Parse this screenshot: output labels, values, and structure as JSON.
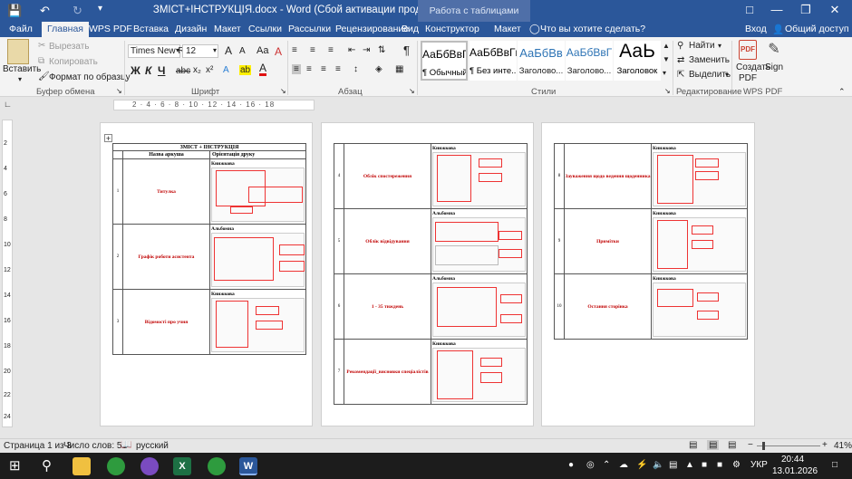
{
  "titlebar": {
    "title": "ЗМІСТ+ІНСТРУКЦІЯ.docx - Word (Сбой активации продукта)",
    "context_tab": "Работа с таблицами",
    "save_icon": "save-icon",
    "undo_icon": "undo-icon",
    "redo_icon": "redo-icon",
    "customize_icon": "customize-icon"
  },
  "tabs": [
    "Файл",
    "Главная",
    "WPS PDF",
    "Вставка",
    "Дизайн",
    "Макет",
    "Ссылки",
    "Рассылки",
    "Рецензирование",
    "Вид",
    "Конструктор",
    "Макет"
  ],
  "tell_me": "Что вы хотите сделать?",
  "signin": "Вход",
  "share": "Общий доступ",
  "clipboard": {
    "paste": "Вставить",
    "cut": "Вырезать",
    "copy": "Копировать",
    "format_painter": "Формат по образцу",
    "label": "Буфер обмена"
  },
  "font": {
    "name": "Times New R",
    "size": "12",
    "label": "Шрифт",
    "bold": "Ж",
    "italic": "К",
    "underline": "Ч",
    "strike": "abc",
    "sub": "x₂",
    "sup": "x²",
    "font_color_glyph": "A",
    "highlight_glyph": "ab",
    "grow": "A",
    "shrink": "A",
    "change_case": "Aa",
    "clear_format": "A"
  },
  "paragraph": {
    "label": "Абзац",
    "pilcrow": "¶"
  },
  "styles": {
    "label": "Стили",
    "items": [
      {
        "preview": "АаБбВвГг,",
        "name": "¶ Обычный"
      },
      {
        "preview": "АаБбВвГг,",
        "name": "¶ Без инте..."
      },
      {
        "preview": "АаБбВв",
        "name": "Заголово..."
      },
      {
        "preview": "АаБбВвГ",
        "name": "Заголово..."
      },
      {
        "preview": "АаЬ",
        "name": "Заголовок"
      }
    ]
  },
  "editing": {
    "find": "Найти",
    "replace": "Заменить",
    "select": "Выделить",
    "label": "Редактирование"
  },
  "wps": {
    "create": "Создать PDF",
    "sign": "Sign",
    "label": "WPS PDF"
  },
  "ruler_numbers": "2 · 4 · 6 · 8 · 10 · 12 · 14 · 16 · 18",
  "vruler_numbers": [
    "2",
    "4",
    "6",
    "8",
    "10",
    "12",
    "14",
    "16",
    "18",
    "20",
    "22",
    "24"
  ],
  "doc": {
    "header": "ЗМІСТ + ІНСТРУКЦІЯ",
    "col1": "Назва аркуша",
    "col2": "Орієнтація друку",
    "rows_page1": [
      {
        "num": "1",
        "name": "Титулка",
        "orient": "Книжкова"
      },
      {
        "num": "2",
        "name": "Графік роботи асистента",
        "orient": "Альбомна"
      },
      {
        "num": "3",
        "name": "Відомості про учня",
        "orient": "Книжкова"
      }
    ],
    "rows_page2": [
      {
        "num": "4",
        "name": "Облік спостереження",
        "orient": "Книжкова"
      },
      {
        "num": "5",
        "name": "Облік відвідування",
        "orient": "Альбомна"
      },
      {
        "num": "6",
        "name": "1 - 35 тиждень",
        "orient": "Альбомна"
      },
      {
        "num": "7",
        "name": "Рекомендації_висновки спеціалістів",
        "orient": "Книжкова"
      }
    ],
    "rows_page3": [
      {
        "num": "8",
        "name": "Зауваження щодо ведення щоденника",
        "orient": "Книжкова"
      },
      {
        "num": "9",
        "name": "Примітки",
        "orient": "Книжкова"
      },
      {
        "num": "10",
        "name": "Остання сторінка",
        "orient": "Книжкова"
      }
    ],
    "move_handle_glyph": "+"
  },
  "status": {
    "page": "Страница 1 из 3",
    "words": "Число слов: 51",
    "lang": "русский",
    "zoom": "41%",
    "zoom_minus": "−",
    "zoom_plus": "+"
  },
  "taskbar": {
    "lang": "УКР",
    "time": "20:44",
    "date": "13.01.2026"
  }
}
